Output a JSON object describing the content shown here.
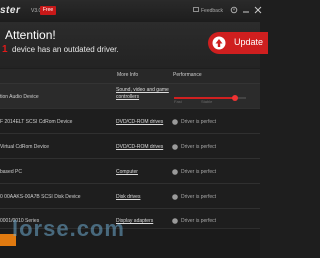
{
  "window": {
    "app_name": "ster",
    "version": "V3.0",
    "badge": "Free",
    "feedback_label": "Feedback"
  },
  "header": {
    "title": "Attention!",
    "outdated_count": "1",
    "outdated_message": "device has an outdated driver.",
    "update_button": "Update"
  },
  "table": {
    "columns": [
      "More Info",
      "Performance"
    ],
    "performance_scale": [
      "Fast",
      "Stable"
    ],
    "performance_level": 0.85,
    "rows": [
      {
        "name": "tion Audio Device",
        "link": "Sound, video and game controllers",
        "status": ""
      },
      {
        "name": "F 2014ELT SCSI CdRom Device",
        "link": "DVD/CD-ROM drives",
        "status": "Driver is perfect"
      },
      {
        "name": "Virtual CdRom Device",
        "link": "DVD/CD-ROM drives",
        "status": "Driver is perfect"
      },
      {
        "name": "based PC",
        "link": "Computer",
        "status": "Driver is perfect"
      },
      {
        "name": "0 00AAKS-00A7B SCSI Disk Device",
        "link": "Disk drives",
        "status": "Driver is perfect"
      },
      {
        "name": "0001/0010 Series",
        "link": "Display adapters",
        "status": "Driver is perfect"
      }
    ]
  },
  "watermark": "lorse.com",
  "colors": {
    "accent": "#cf1f1f",
    "background": "#1e1e1e",
    "perfect_icon": "#9a9a9a",
    "footer_button": "#e07a10"
  }
}
